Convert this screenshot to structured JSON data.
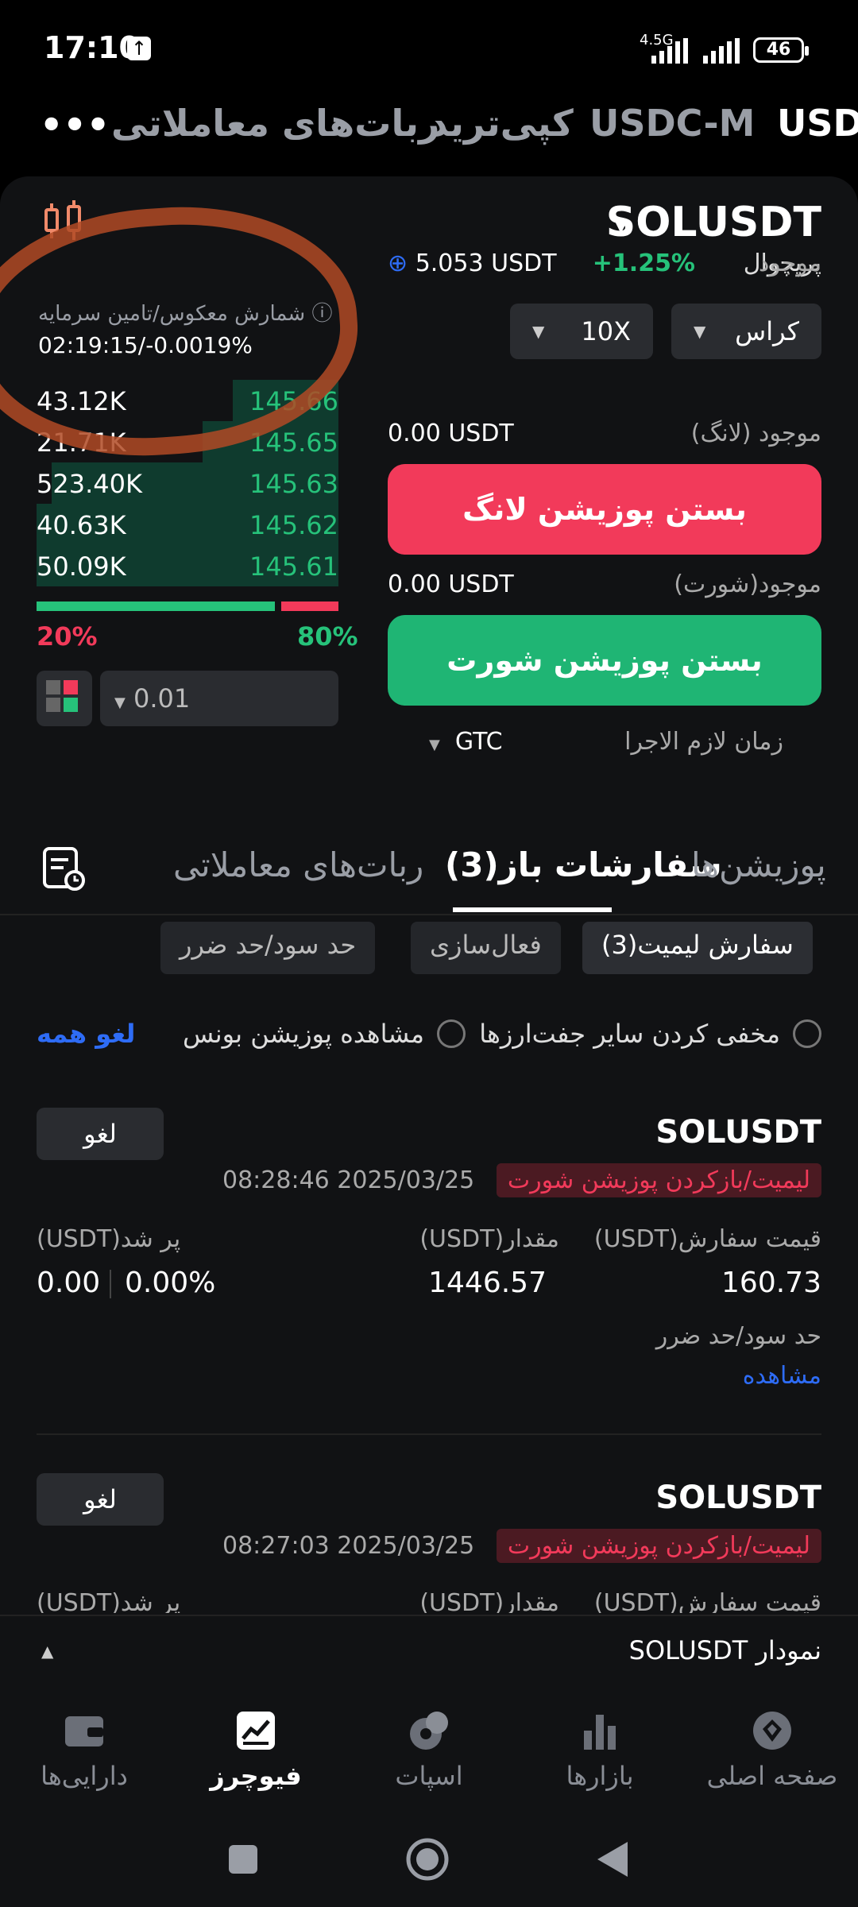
{
  "status_bar": {
    "time": "17:10",
    "network": "4.5G",
    "battery": "46"
  },
  "top_nav": {
    "tabs": [
      "USDT",
      "USDC-M",
      "کپی‌ترید",
      "ربات‌های معاملاتی"
    ],
    "more": "•••"
  },
  "header": {
    "pair": "SOLUSDT",
    "type": "پرپچوال",
    "change": "+1.25%",
    "funding_label": "شمارش معکوس/تامین سرمایه",
    "funding_value": "02:19:15/-0.0019%"
  },
  "controls": {
    "margin_mode": "کراس",
    "leverage": "10X"
  },
  "order_book": {
    "rows": [
      {
        "amount": "43.12K",
        "price": "145.66",
        "depth": 0.35
      },
      {
        "amount": "21.71K",
        "price": "145.65",
        "depth": 0.45
      },
      {
        "amount": "523.40K",
        "price": "145.63",
        "depth": 0.95
      },
      {
        "amount": "40.63K",
        "price": "145.62",
        "depth": 1.0
      },
      {
        "amount": "50.09K",
        "price": "145.61",
        "depth": 1.0
      }
    ],
    "sell_pct": "20%",
    "buy_pct": "80%",
    "buy_ratio": 0.8,
    "step": "0.01"
  },
  "trade": {
    "available_label": "موجود",
    "available_value": "5.053 USDT",
    "long_label": "موجود (لانگ)",
    "long_value": "0.00 USDT",
    "close_long": "بستن پوزیشن لانگ",
    "short_label": "موجود(شورت)",
    "short_value": "0.00 USDT",
    "close_short": "بستن پوزیشن شورت",
    "tif_label": "زمان لازم الاجرا",
    "tif_value": "GTC"
  },
  "tabs": {
    "positions": "پوزیشن‌ها",
    "open_orders": "سفارشات باز(3)",
    "bots": "ربات‌های معاملاتی"
  },
  "filters": {
    "limit": "سفارش لیمیت(3)",
    "trigger": "فعال‌سازی",
    "tpsl": "حد سود/حد ضرر"
  },
  "options": {
    "hide_pairs": "مخفی کردن سایر جفت‌ارزها",
    "show_bonus": "مشاهده پوزیشن بونس",
    "cancel_all": "لغو همه"
  },
  "orders": [
    {
      "pair": "SOLUSDT",
      "cancel": "لغو",
      "type": "لیمیت/بازکردن پوزیشن شورت",
      "time": "08:28:46 2025/03/25",
      "price_label": "قیمت سفارش(USDT)",
      "price": "160.73",
      "qty_label": "مقدار(USDT)",
      "qty": "1446.57",
      "filled_label": "پر شد(USDT)",
      "filled": "0.00",
      "filled_pct": "0.00%",
      "tpsl_label": "حد سود/حد ضرر",
      "tpsl_link": "مشاهده"
    },
    {
      "pair": "SOLUSDT",
      "cancel": "لغو",
      "type": "لیمیت/بازکردن پوزیشن شورت",
      "time": "08:27:03 2025/03/25",
      "price_label": "قیمت سفارش(USDT)",
      "qty_label": "مقدار(USDT)",
      "filled_label": "پر شد(USDT)"
    }
  ],
  "chart_bar": {
    "title": "نمودار SOLUSDT"
  },
  "bottom_nav": [
    "صفحه اصلی",
    "بازارها",
    "اسپات",
    "فیوچرز",
    "دارایی‌ها"
  ],
  "colors": {
    "green": "#26c27a",
    "red": "#f23a5a",
    "accent": "#2e6cf6"
  }
}
